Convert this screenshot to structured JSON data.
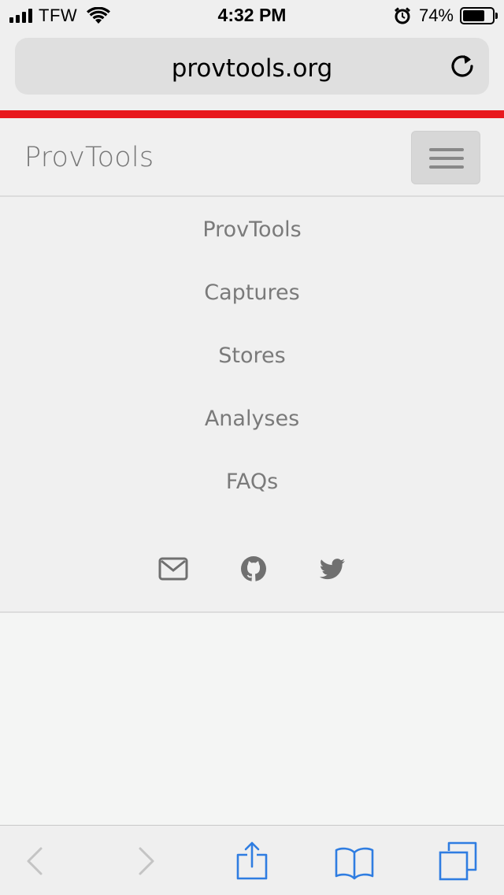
{
  "status_bar": {
    "carrier": "TFW",
    "time": "4:32 PM",
    "battery_percent": "74%",
    "battery_level": 0.74,
    "icons": [
      "signal-icon",
      "wifi-icon",
      "alarm-icon",
      "battery-icon"
    ]
  },
  "browser": {
    "url": "provtools.org",
    "reload_icon": "reload-icon",
    "toolbar_icons": [
      "back-icon",
      "forward-icon",
      "share-icon",
      "bookmarks-icon",
      "tabs-icon"
    ]
  },
  "site": {
    "brand": "ProvTools",
    "menu_toggle_icon": "hamburger-icon",
    "accent_color": "#e8191e",
    "menu": [
      {
        "label": "ProvTools"
      },
      {
        "label": "Captures"
      },
      {
        "label": "Stores"
      },
      {
        "label": "Analyses"
      },
      {
        "label": "FAQs"
      }
    ],
    "social_icons": [
      "mail-icon",
      "github-icon",
      "twitter-icon"
    ]
  }
}
